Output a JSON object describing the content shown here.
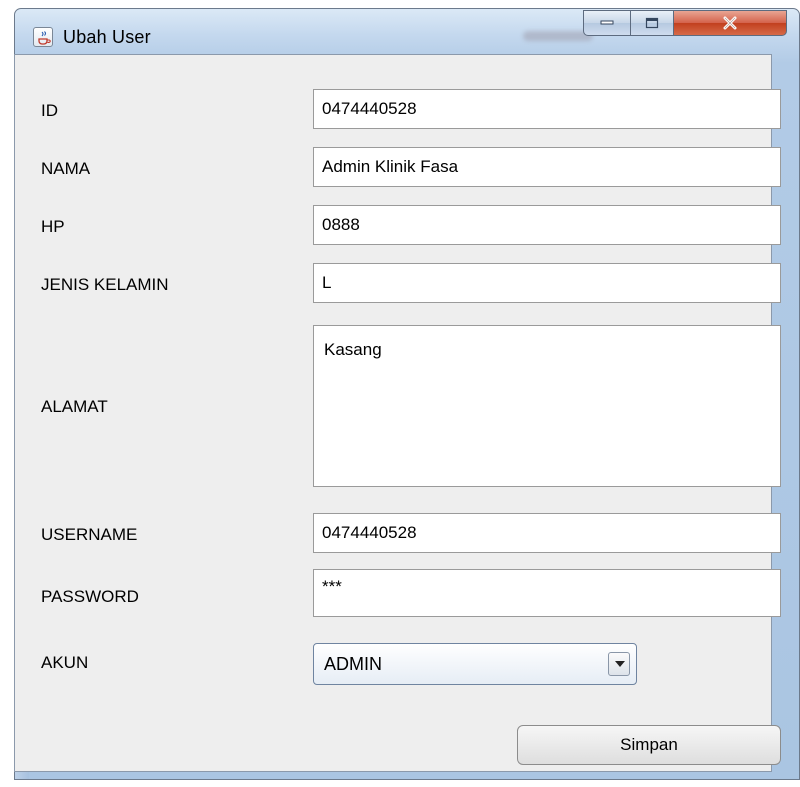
{
  "window": {
    "title": "Ubah User",
    "icon": "java-cup-icon",
    "controls": {
      "minimize": "minimize-icon",
      "maximize": "maximize-icon",
      "close": "close-icon"
    }
  },
  "form": {
    "id": {
      "label": "ID",
      "value": "0474440528"
    },
    "nama": {
      "label": "NAMA",
      "value": "Admin Klinik Fasa"
    },
    "hp": {
      "label": "HP",
      "value": "0888"
    },
    "jenis_kelamin": {
      "label": "JENIS KELAMIN",
      "value": "L"
    },
    "alamat": {
      "label": "ALAMAT",
      "value": "Kasang"
    },
    "username": {
      "label": "USERNAME",
      "value": "0474440528"
    },
    "password": {
      "label": "PASSWORD",
      "value": "***"
    },
    "akun": {
      "label": "AKUN",
      "selected": "ADMIN"
    }
  },
  "buttons": {
    "save_label": "Simpan"
  }
}
